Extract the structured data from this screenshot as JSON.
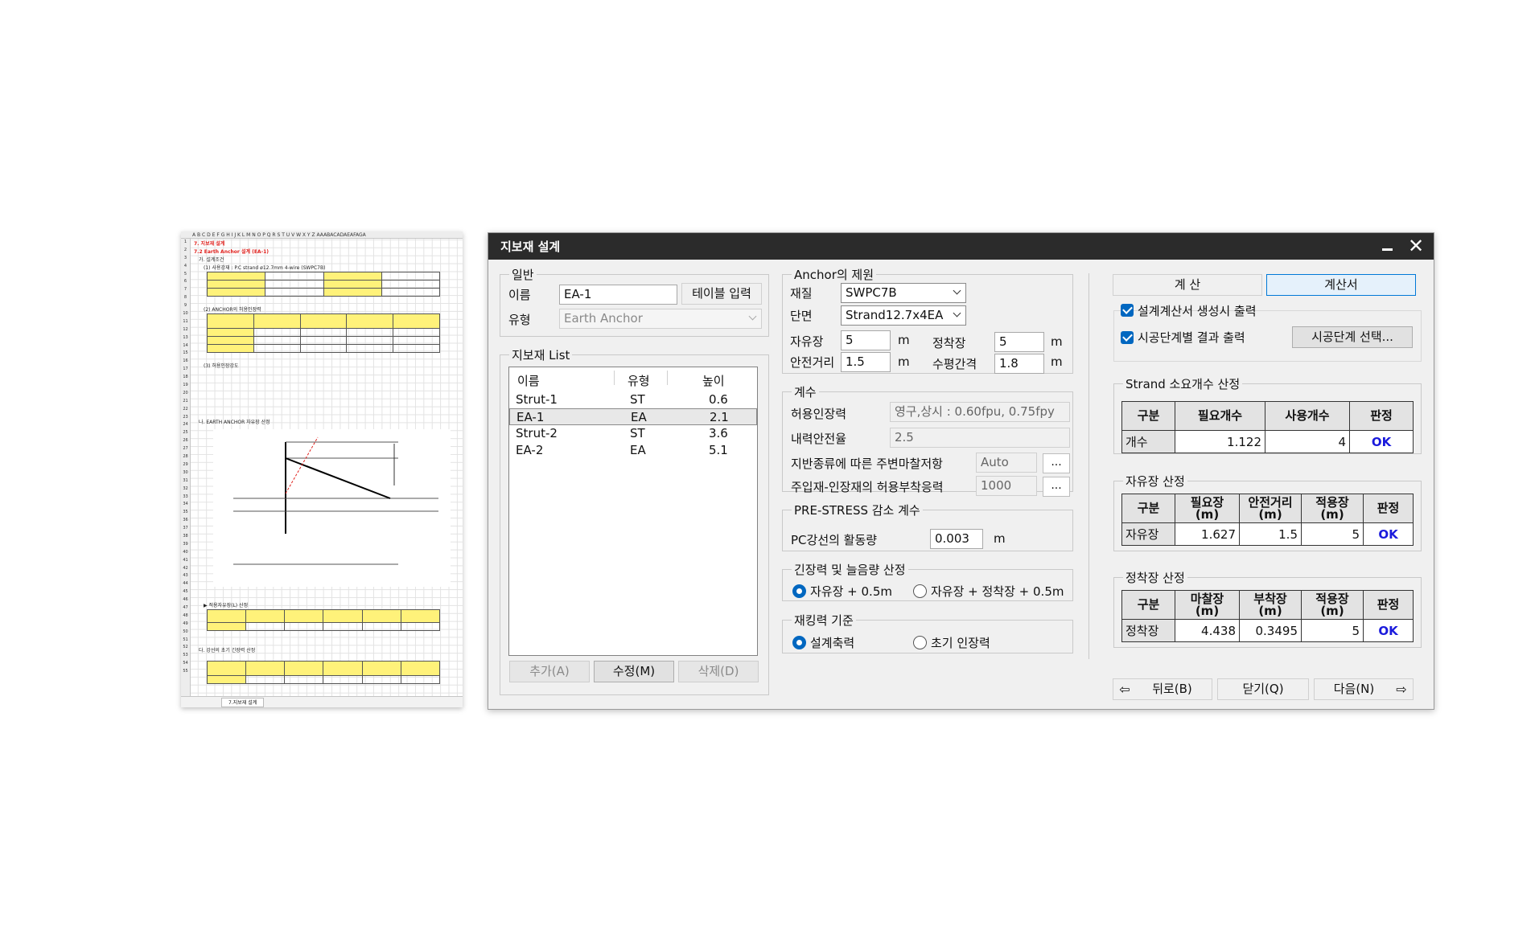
{
  "sheet": {
    "col_headers": "A B C D E F G H I J K L M N O P Q R S T U V W X Y Z AAABACADAEAFAGA",
    "row_numbers": [
      "1",
      "2",
      "3",
      "4",
      "5",
      "6",
      "7",
      "8",
      "9",
      "10",
      "11",
      "12",
      "13",
      "14",
      "15",
      "16",
      "17",
      "18",
      "19",
      "20",
      "21",
      "22",
      "23",
      "24",
      "25",
      "26",
      "27",
      "28",
      "29",
      "30",
      "31",
      "32",
      "33",
      "34",
      "35",
      "36",
      "37",
      "38",
      "39",
      "40",
      "41",
      "42",
      "43",
      "44",
      "45",
      "46",
      "47",
      "48",
      "49",
      "50",
      "51",
      "52",
      "53",
      "54",
      "55"
    ],
    "heading1": "7. 지보재 설계",
    "heading2": "7.2 Earth Anchor 설계 (EA-1)",
    "line_design_cond": "가. 설계조건",
    "line_material": "(1) 사용강재 : P.C strand ø12.7mm 4-wire (SWPC7B)",
    "line_allow": "(2) ANCHOR의 허용인장력",
    "line_free": "(3) 허용인장강도",
    "line_earth": "나. EARTH ANCHOR 자유장 산정",
    "line_fixlen": "▶ 적용자유장(L) 산정",
    "line_initial": "다. 강선의 초기 긴장력 산정",
    "tab_name": "7.지보재 설계"
  },
  "dialog": {
    "title": "지보재 설계",
    "general": {
      "group_label": "일반",
      "name_label": "이름",
      "name_value": "EA-1",
      "table_button": "테이블 입력",
      "type_label": "유형",
      "type_value": "Earth Anchor"
    },
    "list": {
      "group_label": "지보재 List",
      "col_name": "이름",
      "col_type": "유형",
      "col_height": "높이",
      "rows": [
        {
          "name": "Strut-1",
          "type": "ST",
          "height": "0.6"
        },
        {
          "name": "EA-1",
          "type": "EA",
          "height": "2.1"
        },
        {
          "name": "Strut-2",
          "type": "ST",
          "height": "3.6"
        },
        {
          "name": "EA-2",
          "type": "EA",
          "height": "5.1"
        }
      ],
      "add_button": "추가(A)",
      "edit_button": "수정(M)",
      "delete_button": "삭제(D)"
    },
    "anchor": {
      "group_label": "Anchor의 제원",
      "material_label": "재질",
      "material_value": "SWPC7B",
      "section_label": "단면",
      "section_value": "Strand12.7x4EA",
      "free_len_label": "자유장",
      "free_len_value": "5",
      "free_len_unit": "m",
      "fix_len_label": "정착장",
      "fix_len_value": "5",
      "fix_len_unit": "m",
      "safe_dist_label": "안전거리",
      "safe_dist_value": "1.5",
      "safe_dist_unit": "m",
      "h_spacing_label": "수평간격",
      "h_spacing_value": "1.8",
      "h_spacing_unit": "m"
    },
    "coef": {
      "group_label": "계수",
      "allow_label": "허용인장력",
      "allow_value": "영구,상시 : 0.60fpu, 0.75fpy",
      "safety_label": "내력안전율",
      "safety_value": "2.5",
      "friction_label": "지반종류에 따른 주변마찰저항",
      "friction_value": "Auto",
      "bond_label": "주입재-인장재의 허용부착응력",
      "bond_value": "1000",
      "dots": "..."
    },
    "prestress": {
      "group_label": "PRE-STRESS 감소 계수",
      "slip_label": "PC강선의 활동량",
      "slip_value": "0.003",
      "slip_unit": "m"
    },
    "tension": {
      "group_label": "긴장력 및 늘음량 산정",
      "opt1": "자유장 + 0.5m",
      "opt2": "자유장 + 정착장 + 0.5m"
    },
    "retension": {
      "group_label": "재킹력 기준",
      "opt1": "설계축력",
      "opt2": "초기 인장력"
    },
    "right": {
      "calc_button": "계  산",
      "report_button": "계산서",
      "chk1": "설계계산서 생성시 출력",
      "chk2": "시공단계별 결과 출력",
      "stage_button": "시공단계 선택...",
      "strand": {
        "group_label": "Strand 소요개수 산정",
        "headers": [
          "구분",
          "필요개수",
          "사용개수",
          "판정"
        ],
        "row": [
          "개수",
          "1.122",
          "4",
          "OK"
        ]
      },
      "free": {
        "group_label": "자유장 산정",
        "headers": [
          "구분",
          "필요장\n(m)",
          "안전거리\n(m)",
          "적용장\n(m)",
          "판정"
        ],
        "row": [
          "자유장",
          "1.627",
          "1.5",
          "5",
          "OK"
        ]
      },
      "fix": {
        "group_label": "정착장 산정",
        "headers": [
          "구분",
          "마찰장\n(m)",
          "부착장\n(m)",
          "적용장\n(m)",
          "판정"
        ],
        "row": [
          "정착장",
          "4.438",
          "0.3495",
          "5",
          "OK"
        ]
      }
    },
    "nav": {
      "back": "뒤로(B)",
      "close": "닫기(Q)",
      "next": "다음(N)"
    }
  }
}
